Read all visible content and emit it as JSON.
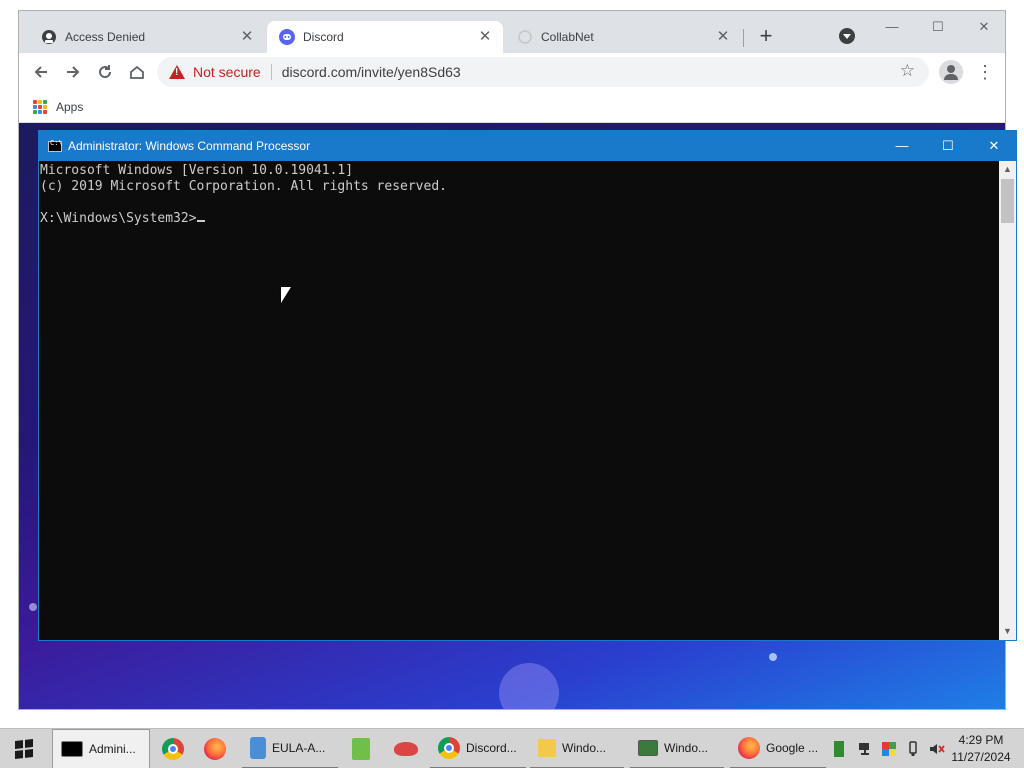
{
  "browser": {
    "tabs": [
      {
        "title": "Access Denied",
        "icon": "incognito-agent-icon",
        "active": false
      },
      {
        "title": "Discord",
        "icon": "discord-icon",
        "active": true
      },
      {
        "title": "CollabNet",
        "icon": "loading-icon",
        "active": false
      }
    ],
    "new_tab": "+",
    "security_label": "Not secure",
    "url": "discord.com/invite/yen8Sd63",
    "bookmarks": [
      {
        "label": "Apps",
        "icon": "apps-grid-icon"
      }
    ],
    "window_controls": {
      "minimize": "—",
      "maximize": "☐",
      "close": "✕"
    },
    "page_gradient": [
      "#1d1a5e",
      "#3b1b99",
      "#1f7fe6"
    ]
  },
  "cmd": {
    "title": "Administrator: Windows Command Processor",
    "lines": [
      "Microsoft Windows [Version 10.0.19041.1]",
      "(c) 2019 Microsoft Corporation. All rights reserved.",
      "",
      "X:\\Windows\\System32>"
    ],
    "controls": {
      "minimize": "—",
      "maximize": "☐",
      "close": "✕"
    },
    "title_color": "#1979ca"
  },
  "taskbar": {
    "items": [
      {
        "label": "Admini...",
        "icon": "cmd-icon"
      },
      {
        "label": "",
        "icon": "chrome-icon"
      },
      {
        "label": "",
        "icon": "firefox-icon"
      },
      {
        "label": "EULA-A...",
        "icon": "document-icon"
      },
      {
        "label": "",
        "icon": "notepad-icon"
      },
      {
        "label": "",
        "icon": "tool-icon"
      },
      {
        "label": "Discord...",
        "icon": "chrome-icon"
      },
      {
        "label": "Windo...",
        "icon": "folder-icon"
      },
      {
        "label": "Windo...",
        "icon": "window-icon"
      },
      {
        "label": "Google ...",
        "icon": "firefox-icon"
      }
    ],
    "clock": {
      "time": "4:29 PM",
      "date": "11/27/2024"
    }
  }
}
